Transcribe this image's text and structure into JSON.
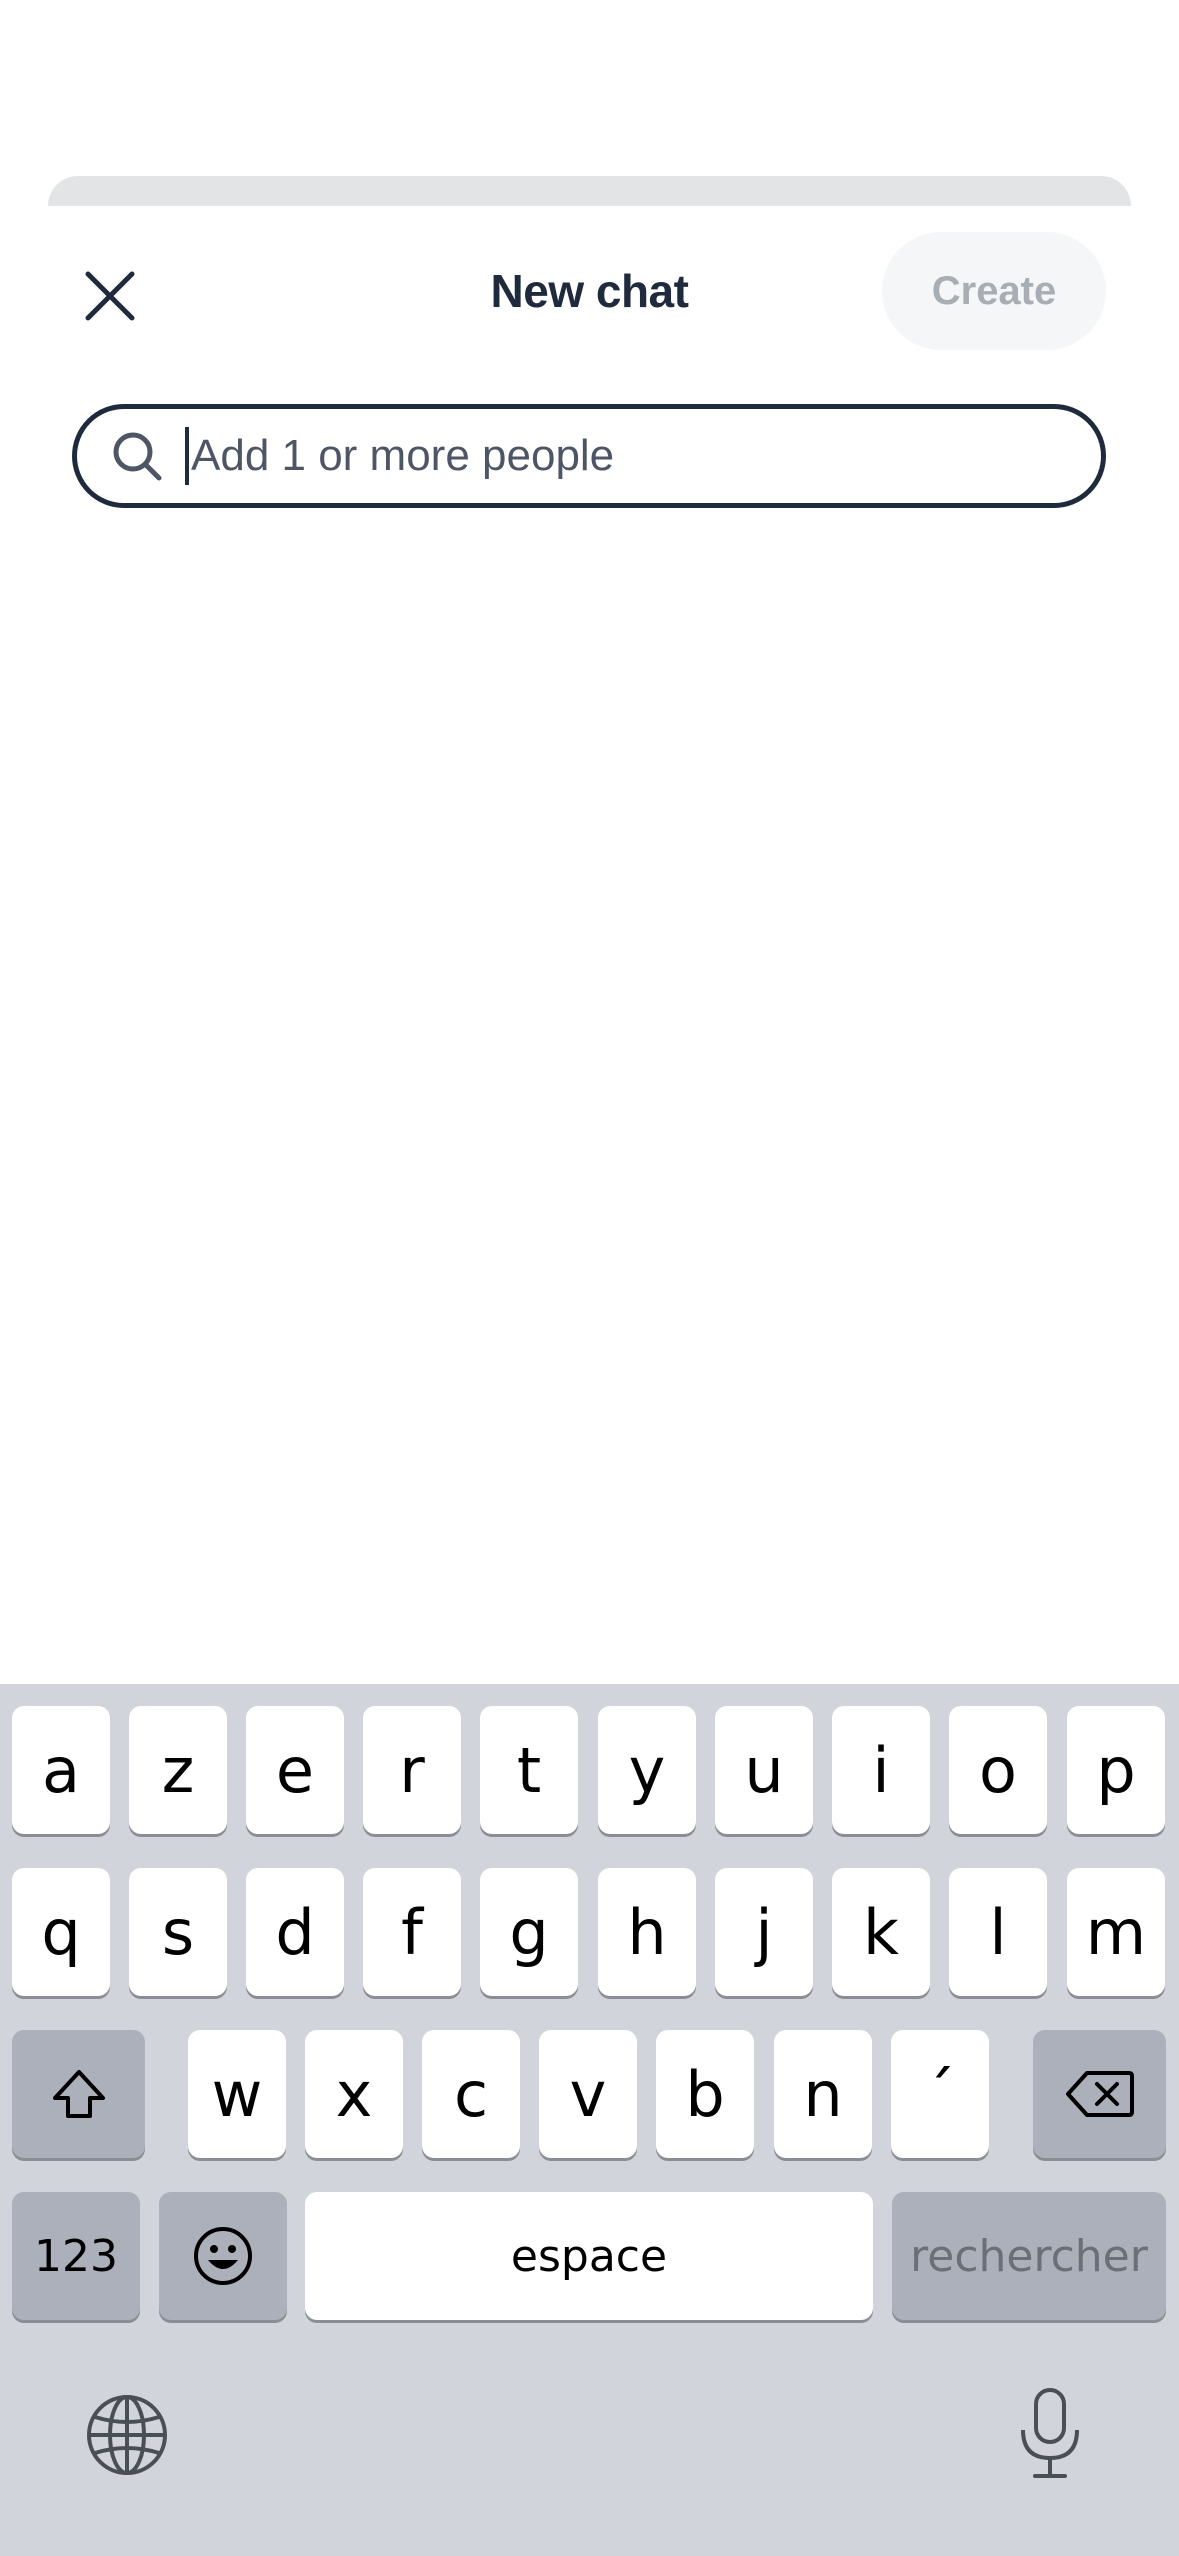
{
  "header": {
    "title": "New chat",
    "create_label": "Create"
  },
  "search": {
    "placeholder": "Add 1 or more people",
    "value": "",
    "icon": "search-icon"
  },
  "keyboard": {
    "row1": [
      "a",
      "z",
      "e",
      "r",
      "t",
      "y",
      "u",
      "i",
      "o",
      "p"
    ],
    "row2": [
      "q",
      "s",
      "d",
      "f",
      "g",
      "h",
      "j",
      "k",
      "l",
      "m"
    ],
    "row3": [
      "w",
      "x",
      "c",
      "v",
      "b",
      "n",
      "´"
    ],
    "numbers_label": "123",
    "space_label": "espace",
    "search_label": "rechercher",
    "icons": [
      "shift-icon",
      "backspace-icon",
      "emoji-icon",
      "globe-icon",
      "microphone-icon"
    ]
  },
  "colors": {
    "text_dark": "#1f2a3c",
    "keyboard_bg": "#d1d4db",
    "key_gray": "#abb0ba",
    "create_bg": "#f5f6f8",
    "create_text": "#a9adb4"
  }
}
